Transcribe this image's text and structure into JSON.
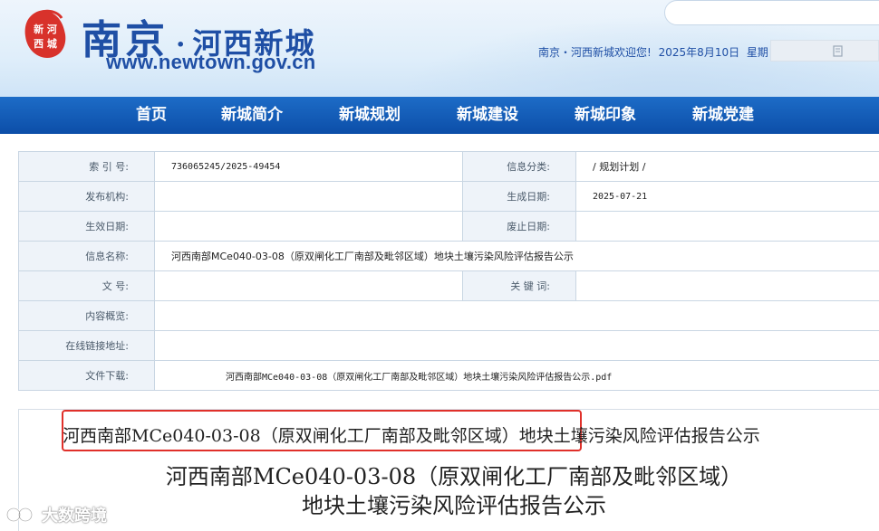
{
  "header": {
    "logo_city": "南京",
    "logo_dot": "·",
    "logo_district": "河西新城",
    "logo_url": "www.newtown.gov.cn",
    "emblem_text": "新河西城",
    "welcome": "南京・河西新城欢迎您!",
    "date": "2025年8月10日",
    "weekday": "星期日",
    "util_icon": "document-icon"
  },
  "nav": {
    "items": [
      "首页",
      "新城简介",
      "新城规划",
      "新城建设",
      "新城印象",
      "新城党建"
    ]
  },
  "info": {
    "index_label": "索 引 号:",
    "index_value": "736065245/2025-49454",
    "category_label": "信息分类:",
    "category_value": "/ 规划计划 /",
    "publisher_label": "发布机构:",
    "publisher_value": "",
    "generated_label": "生成日期:",
    "generated_value": "2025-07-21",
    "effective_label": "生效日期:",
    "effective_value": "",
    "expiry_label": "废止日期:",
    "expiry_value": "",
    "name_label": "信息名称:",
    "name_value": "河西南部MCe040-03-08（原双闸化工厂南部及毗邻区域）地块土壤污染风险评估报告公示",
    "docno_label": "文 号:",
    "docno_value": "",
    "keywords_label": "关 键 词:",
    "keywords_value": "",
    "summary_label": "内容概览:",
    "summary_value": "",
    "link_label": "在线链接地址:",
    "link_value": "",
    "download_label": "文件下载:",
    "download_value": "河西南部MCe040-03-08（原双闸化工厂南部及毗邻区域）地块土壤污染风险评估报告公示.pdf"
  },
  "article": {
    "small_title": "河西南部MCe040-03-08（原双闸化工厂南部及毗邻区域）地块土壤污染风险评估报告公示",
    "big_title_line1": "河西南部MCe040-03-08（原双闸化工厂南部及毗邻区域）",
    "big_title_line2": "地块土壤污染风险评估报告公示"
  },
  "watermark": {
    "text": "大数跨境"
  },
  "colors": {
    "brand_blue": "#1f4fa5",
    "nav_blue": "#0c4ea8",
    "highlight_red": "#e0302a"
  }
}
